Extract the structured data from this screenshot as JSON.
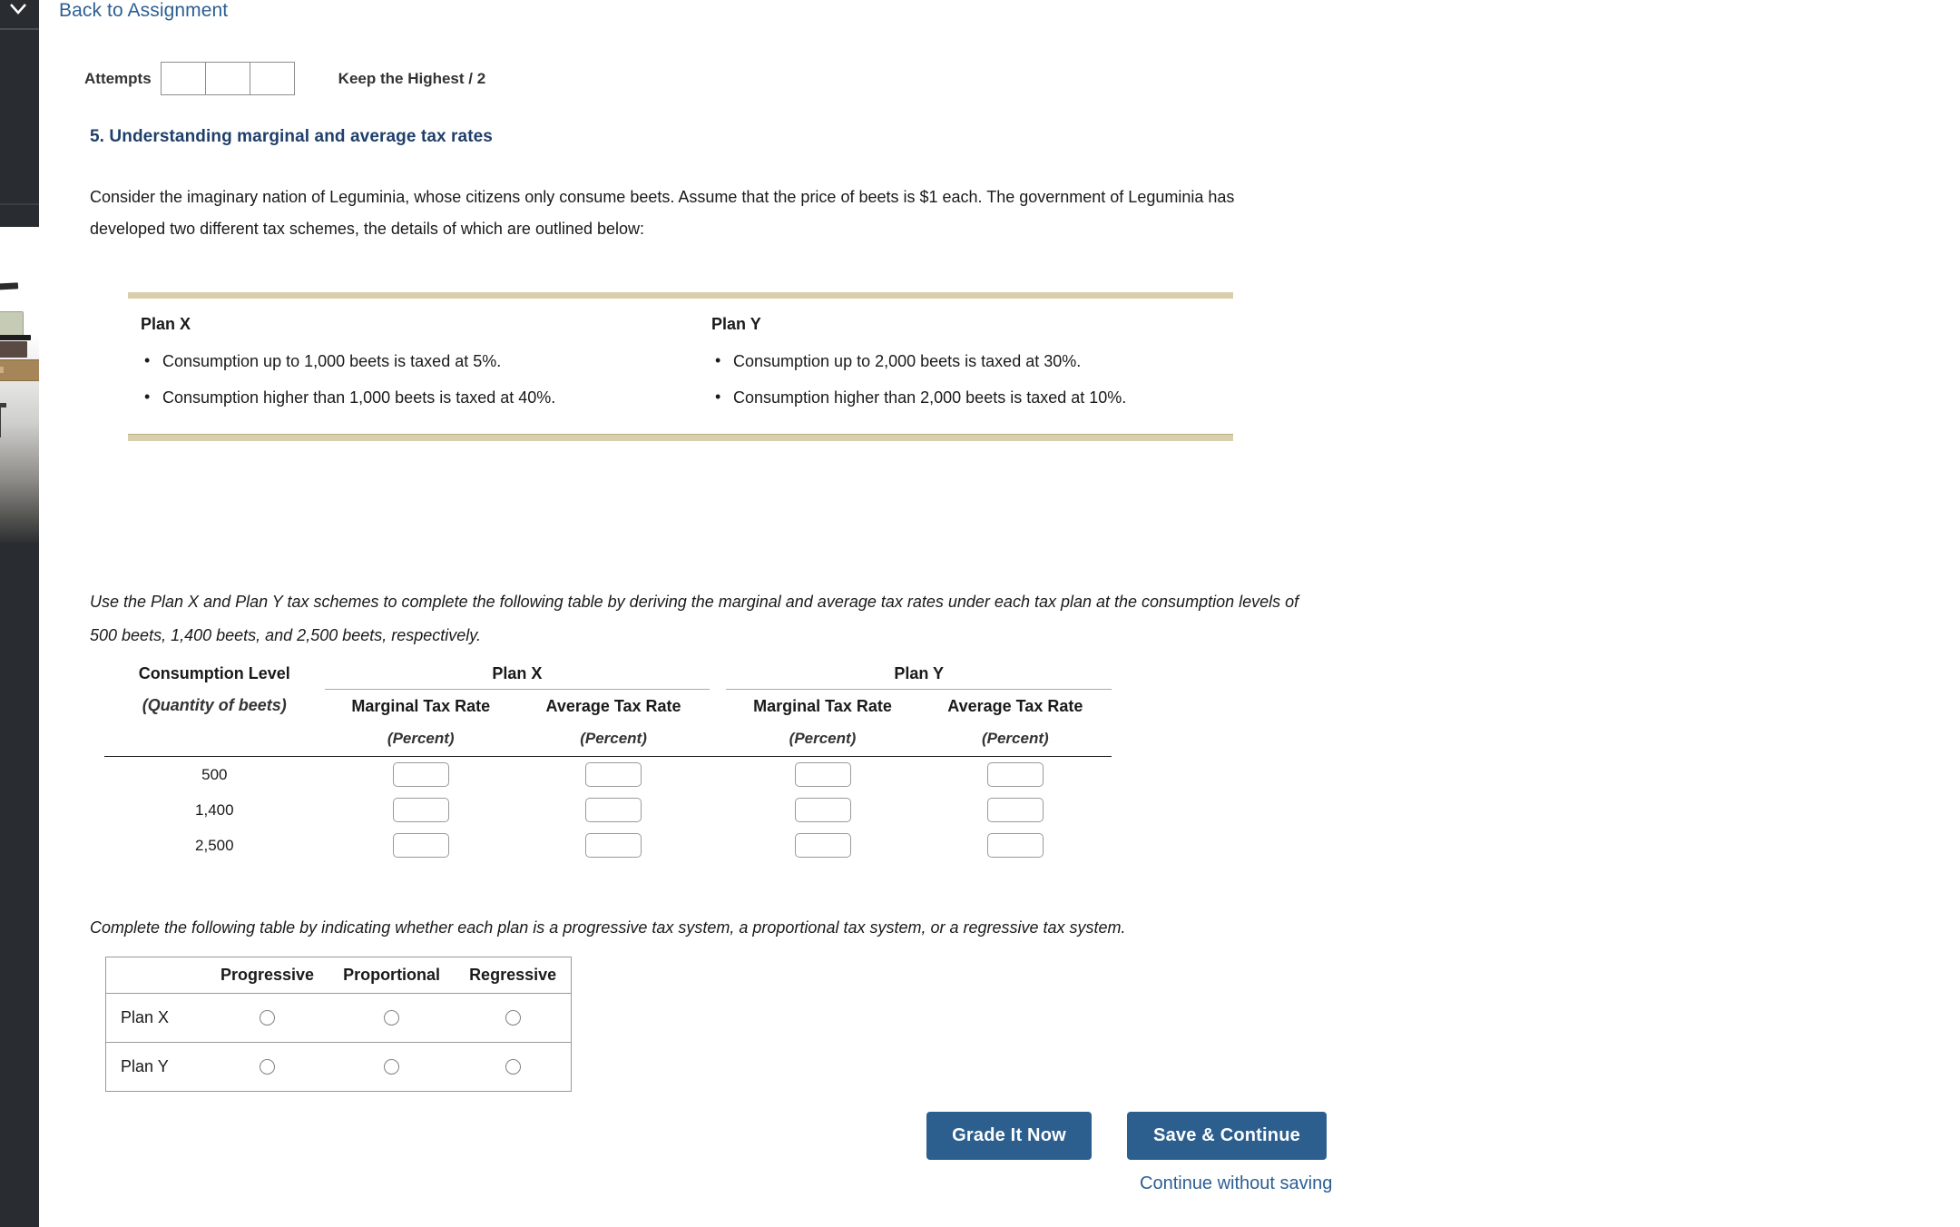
{
  "rail": {
    "chevron_icon": "chevron-down-icon"
  },
  "nav": {
    "back_link": "Back to Assignment"
  },
  "attempts": {
    "label": "Attempts",
    "boxes": [
      "",
      "",
      ""
    ],
    "keep_highest": "Keep the Highest / 2"
  },
  "question": {
    "title": "5. Understanding marginal and average tax rates",
    "intro": "Consider the imaginary nation of Leguminia, whose citizens only consume beets. Assume that the price of beets is $1 each. The government of Leguminia has developed two different tax schemes, the details of which are outlined below:"
  },
  "plans": [
    {
      "name": "Plan X",
      "bullets": [
        "Consumption up to 1,000 beets is taxed at 5%.",
        "Consumption higher than 1,000 beets is taxed at 40%."
      ]
    },
    {
      "name": "Plan Y",
      "bullets": [
        "Consumption up to 2,000 beets is taxed at 30%.",
        "Consumption higher than 2,000 beets is taxed at 10%."
      ]
    }
  ],
  "rates_instruction": "Use the Plan X and Plan Y tax schemes to complete the following table by deriving the marginal and average tax rates under each tax plan at the consumption levels of 500 beets, 1,400 beets, and 2,500 beets, respectively.",
  "rates_table": {
    "consumption_header": "Consumption Level",
    "consumption_subheader": "(Quantity of beets)",
    "plan_x_header": "Plan X",
    "plan_y_header": "Plan Y",
    "col_marginal": "Marginal Tax Rate",
    "col_average": "Average Tax Rate",
    "unit": "(Percent)",
    "rows": [
      {
        "level": "500",
        "x_marginal": "",
        "x_average": "",
        "y_marginal": "",
        "y_average": ""
      },
      {
        "level": "1,400",
        "x_marginal": "",
        "x_average": "",
        "y_marginal": "",
        "y_average": ""
      },
      {
        "level": "2,500",
        "x_marginal": "",
        "x_average": "",
        "y_marginal": "",
        "y_average": ""
      }
    ]
  },
  "classify_instruction": "Complete the following table by indicating whether each plan is a progressive tax system, a proportional tax system, or a regressive tax system.",
  "classify_table": {
    "columns": [
      "Progressive",
      "Proportional",
      "Regressive"
    ],
    "rows": [
      {
        "label": "Plan X",
        "selected": ""
      },
      {
        "label": "Plan Y",
        "selected": ""
      }
    ]
  },
  "footer": {
    "grade_button": "Grade It Now",
    "save_button": "Save & Continue",
    "continue_link": "Continue without saving"
  },
  "colors": {
    "accent_blue": "#2c5f8e",
    "link_blue": "#2c5f93",
    "heading_navy": "#1f3f6b",
    "panel_rule": "#d9cfad",
    "rail_dark": "#292d31"
  }
}
